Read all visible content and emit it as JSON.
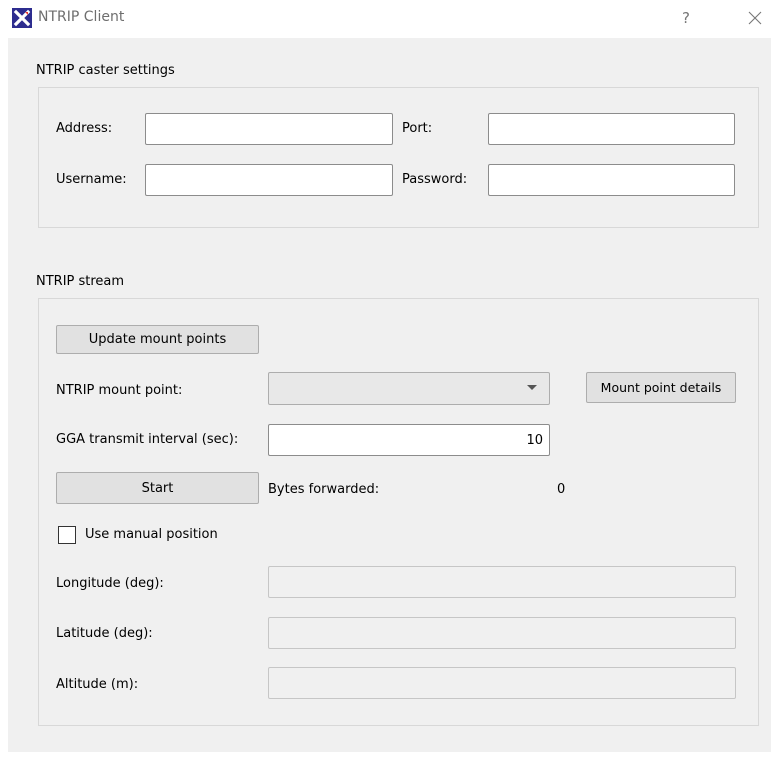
{
  "window": {
    "title": "NTRIP Client",
    "help_glyph": "?",
    "app_icon": "x-logo-icon",
    "accent_color": "#2d2c8f"
  },
  "caster": {
    "group_title": "NTRIP caster settings",
    "address_label": "Address:",
    "address_value": "",
    "port_label": "Port:",
    "port_value": "",
    "username_label": "Username:",
    "username_value": "",
    "password_label": "Password:",
    "password_value": ""
  },
  "stream": {
    "group_title": "NTRIP stream",
    "update_button": "Update mount points",
    "mount_point_label": "NTRIP mount point:",
    "mount_point_value": "",
    "mount_details_button": "Mount point details",
    "gga_label": "GGA transmit interval (sec):",
    "gga_value": "10",
    "start_button": "Start",
    "bytes_label": "Bytes forwarded:",
    "bytes_value": "0",
    "manual_position_label": "Use manual position",
    "manual_position_checked": false,
    "longitude_label": "Longitude (deg):",
    "longitude_value": "",
    "latitude_label": "Latitude (deg):",
    "latitude_value": "",
    "altitude_label": "Altitude (m):",
    "altitude_value": ""
  }
}
